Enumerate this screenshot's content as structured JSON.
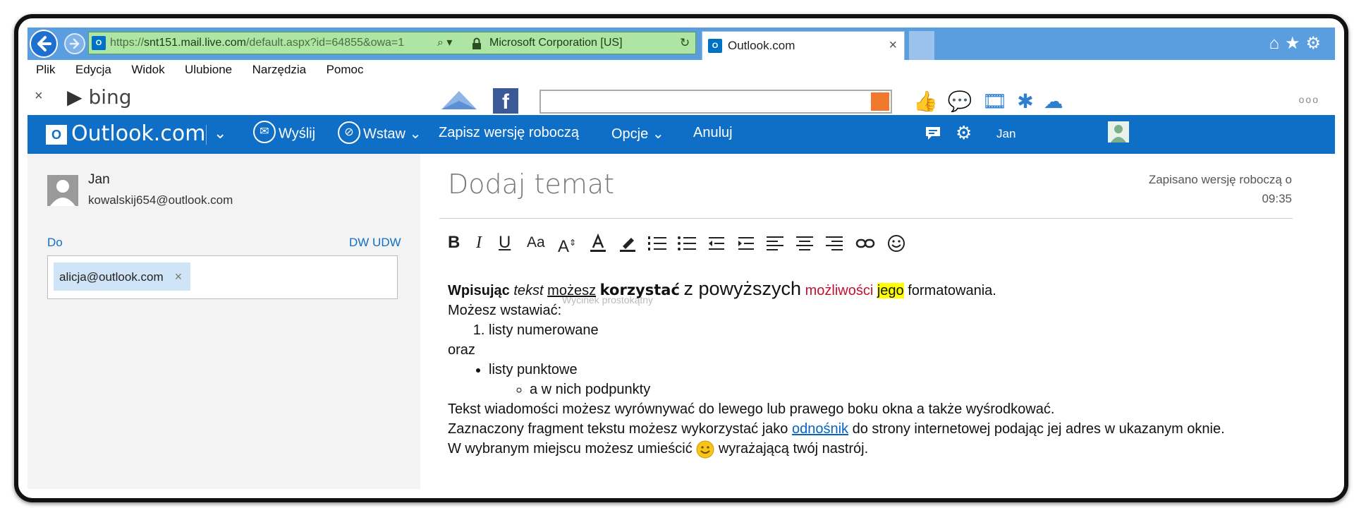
{
  "browser": {
    "url_prefix": "https://",
    "url_host": "snt151.mail.live.com",
    "url_path": "/default.aspx?id=64855&owa=1",
    "cert_label": "Microsoft Corporation [US]",
    "tab_title": "Outlook.com",
    "tab_close": "×"
  },
  "menu": [
    "Plik",
    "Edycja",
    "Widok",
    "Ulubione",
    "Narzędzia",
    "Pomoc"
  ],
  "bing": {
    "close": "×",
    "logo": "bing",
    "more": "ooo"
  },
  "outlook": {
    "logo": "Outlook.com",
    "commands": {
      "send": "Wyślij",
      "insert": "Wstaw",
      "save_draft": "Zapisz wersję roboczą",
      "options": "Opcje",
      "cancel": "Anuluj"
    },
    "user": "Jan"
  },
  "sender": {
    "name": "Jan",
    "email": "kowalskij654@outlook.com"
  },
  "recipients": {
    "to_label": "Do",
    "cc_bcc": "DW UDW",
    "chip": "alicja@outlook.com",
    "chip_remove": "×"
  },
  "compose": {
    "subject_placeholder": "Dodaj temat",
    "saved_line1": "Zapisano wersję roboczą o",
    "saved_line2": "09:35",
    "ghost_tooltip": "Wycinek prostokątny",
    "line1": {
      "bold": "Wpisując",
      "italic": "tekst",
      "underline": "możesz",
      "bold_sans": "korzystać",
      "big": "z powyższych",
      "red": "możliwości",
      "highlight": "jego",
      "rest": "formatowania."
    },
    "line2": "Możesz wstawiać:",
    "numbered_item": "listy numerowane",
    "between": "oraz",
    "bullet_item": "listy punktowe",
    "sub_item": "a w nich podpunkty",
    "line_align": "Tekst wiadomości możesz wyrównywać do lewego lub prawego boku okna a także wyśrodkować.",
    "line_link_before": "Zaznaczony fragment tekstu możesz wykorzystać jako",
    "link_text": "odnośnik",
    "line_link_after": "do strony internetowej podając jej adres w ukazanym oknie.",
    "line_emoji_before": "W wybranym miejscu możesz umieścić",
    "line_emoji_after": "wyrażającą twój nastrój."
  },
  "toolbar": {
    "bold": "B",
    "italic": "I",
    "underline": "U",
    "font_size": "Aa",
    "grow": "A"
  },
  "colors": {
    "outlook_blue": "#0f6fc6",
    "address_green": "#aee4a4",
    "highlight": "#ffff00",
    "red_text": "#c8102e",
    "link": "#0563c1"
  }
}
